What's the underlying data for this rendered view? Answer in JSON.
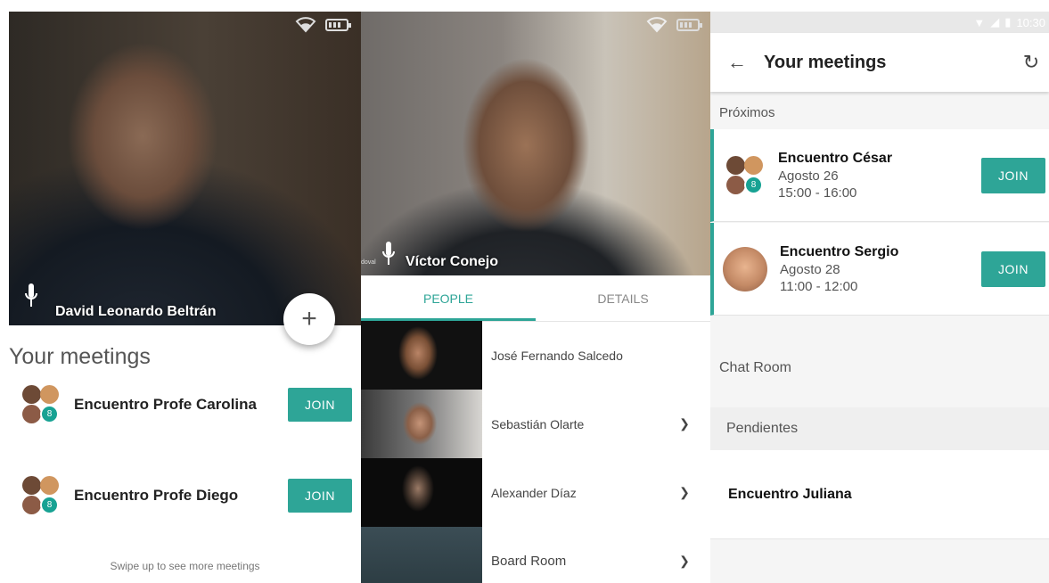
{
  "colors": {
    "accent": "#2ea597"
  },
  "panel1": {
    "participant_name": "David Leonardo Beltrán",
    "fab_label": "+",
    "title": "Your meetings",
    "meetings": [
      {
        "name": "Encuentro Profe Carolina",
        "avatar_count": "8",
        "join_label": "JOIN"
      },
      {
        "name": "Encuentro Profe Diego",
        "avatar_count": "8",
        "join_label": "JOIN"
      }
    ],
    "hint": "Swipe up to see more meetings"
  },
  "panel2": {
    "participant_name": "Víctor Conejo",
    "side_label": "doval",
    "tabs": [
      {
        "label": "PEOPLE"
      },
      {
        "label": "DETAILS"
      }
    ],
    "people": [
      {
        "name": "José Fernando Salcedo"
      },
      {
        "name": "Sebastián Olarte"
      },
      {
        "name": "Alexander Díaz"
      },
      {
        "name": "Board Room"
      }
    ]
  },
  "panel3": {
    "status_time": "10:30",
    "title": "Your meetings",
    "back_icon": "arrow-back-icon",
    "refresh_icon": "refresh-icon",
    "section_upcoming": "Próximos",
    "upcoming": [
      {
        "name": "Encuentro César",
        "date": "Agosto 26",
        "time": "15:00 - 16:00",
        "avatar_count": "8",
        "join_label": "JOIN"
      },
      {
        "name": "Encuentro Sergio",
        "date": "Agosto 28",
        "time": "11:00 - 12:00",
        "join_label": "JOIN"
      }
    ],
    "chat_room": "Chat Room",
    "section_pending": "Pendientes",
    "pending": [
      {
        "name": "Encuentro Juliana"
      }
    ]
  }
}
